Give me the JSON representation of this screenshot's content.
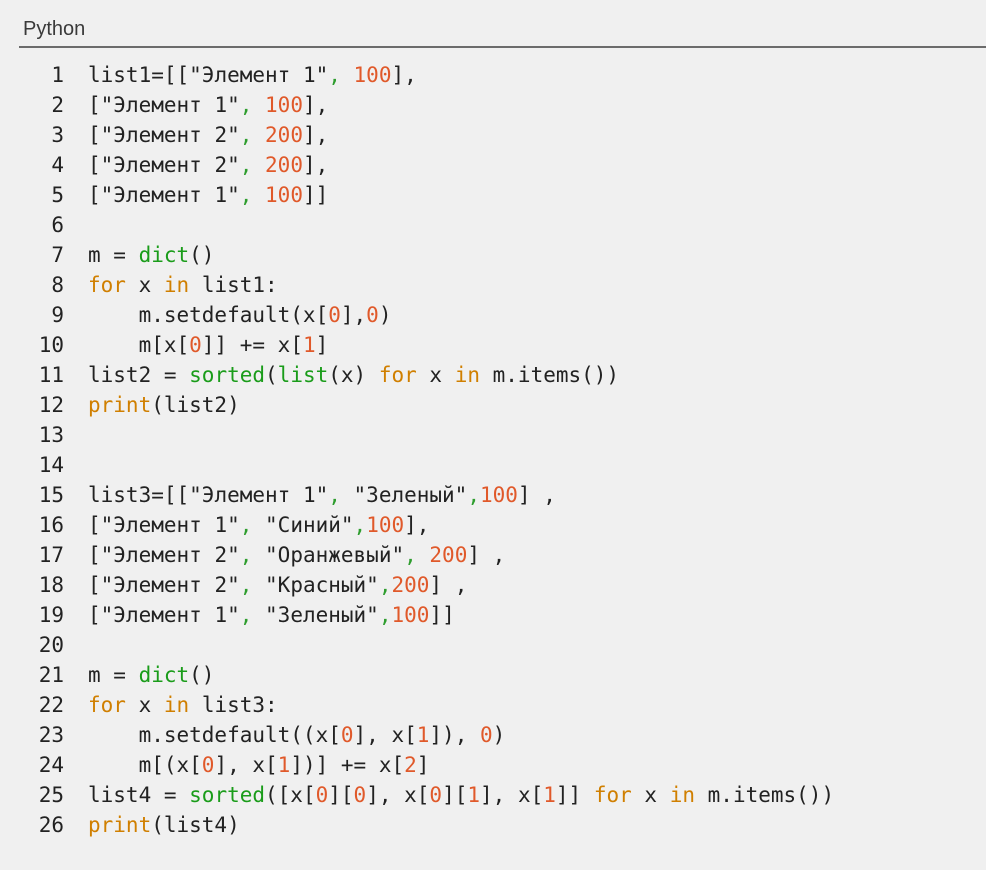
{
  "header": {
    "language": "Python"
  },
  "colors": {
    "keyword": "#d07f00",
    "builtin": "#1a9c1a",
    "number": "#e0592a",
    "punctuation": "#2e9d2e",
    "text": "#222222",
    "background": "#f0f0f0"
  },
  "lines": [
    {
      "num": "1",
      "tokens": [
        {
          "t": "list1=[[",
          "c": "d"
        },
        {
          "t": "\"Элемент 1\"",
          "c": "s"
        },
        {
          "t": ", ",
          "c": "p"
        },
        {
          "t": "100",
          "c": "n"
        },
        {
          "t": "],",
          "c": "d"
        }
      ]
    },
    {
      "num": "2",
      "tokens": [
        {
          "t": "[",
          "c": "d"
        },
        {
          "t": "\"Элемент 1\"",
          "c": "s"
        },
        {
          "t": ", ",
          "c": "p"
        },
        {
          "t": "100",
          "c": "n"
        },
        {
          "t": "],",
          "c": "d"
        }
      ]
    },
    {
      "num": "3",
      "tokens": [
        {
          "t": "[",
          "c": "d"
        },
        {
          "t": "\"Элемент 2\"",
          "c": "s"
        },
        {
          "t": ", ",
          "c": "p"
        },
        {
          "t": "200",
          "c": "n"
        },
        {
          "t": "],",
          "c": "d"
        }
      ]
    },
    {
      "num": "4",
      "tokens": [
        {
          "t": "[",
          "c": "d"
        },
        {
          "t": "\"Элемент 2\"",
          "c": "s"
        },
        {
          "t": ", ",
          "c": "p"
        },
        {
          "t": "200",
          "c": "n"
        },
        {
          "t": "],",
          "c": "d"
        }
      ]
    },
    {
      "num": "5",
      "tokens": [
        {
          "t": "[",
          "c": "d"
        },
        {
          "t": "\"Элемент 1\"",
          "c": "s"
        },
        {
          "t": ", ",
          "c": "p"
        },
        {
          "t": "100",
          "c": "n"
        },
        {
          "t": "]]",
          "c": "d"
        }
      ]
    },
    {
      "num": "6",
      "tokens": []
    },
    {
      "num": "7",
      "tokens": [
        {
          "t": "m = ",
          "c": "d"
        },
        {
          "t": "dict",
          "c": "f"
        },
        {
          "t": "()",
          "c": "d"
        }
      ]
    },
    {
      "num": "8",
      "tokens": [
        {
          "t": "for",
          "c": "k"
        },
        {
          "t": " x ",
          "c": "d"
        },
        {
          "t": "in",
          "c": "k"
        },
        {
          "t": " list1:",
          "c": "d"
        }
      ]
    },
    {
      "num": "9",
      "tokens": [
        {
          "t": "    m.setdefault(x[",
          "c": "d"
        },
        {
          "t": "0",
          "c": "n"
        },
        {
          "t": "],",
          "c": "d"
        },
        {
          "t": "0",
          "c": "n"
        },
        {
          "t": ")",
          "c": "d"
        }
      ]
    },
    {
      "num": "10",
      "tokens": [
        {
          "t": "    m[x[",
          "c": "d"
        },
        {
          "t": "0",
          "c": "n"
        },
        {
          "t": "]] += x[",
          "c": "d"
        },
        {
          "t": "1",
          "c": "n"
        },
        {
          "t": "]",
          "c": "d"
        }
      ]
    },
    {
      "num": "11",
      "tokens": [
        {
          "t": "list2 = ",
          "c": "d"
        },
        {
          "t": "sorted",
          "c": "f"
        },
        {
          "t": "(",
          "c": "d"
        },
        {
          "t": "list",
          "c": "f"
        },
        {
          "t": "(x) ",
          "c": "d"
        },
        {
          "t": "for",
          "c": "k"
        },
        {
          "t": " x ",
          "c": "d"
        },
        {
          "t": "in",
          "c": "k"
        },
        {
          "t": " m.items())",
          "c": "d"
        }
      ]
    },
    {
      "num": "12",
      "tokens": [
        {
          "t": "print",
          "c": "k"
        },
        {
          "t": "(list2)",
          "c": "d"
        }
      ]
    },
    {
      "num": "13",
      "tokens": []
    },
    {
      "num": "14",
      "tokens": []
    },
    {
      "num": "15",
      "tokens": [
        {
          "t": "list3=[[",
          "c": "d"
        },
        {
          "t": "\"Элемент 1\"",
          "c": "s"
        },
        {
          "t": ", ",
          "c": "p"
        },
        {
          "t": "\"Зеленый\"",
          "c": "s"
        },
        {
          "t": ",",
          "c": "p"
        },
        {
          "t": "100",
          "c": "n"
        },
        {
          "t": "] ,",
          "c": "d"
        }
      ]
    },
    {
      "num": "16",
      "tokens": [
        {
          "t": "[",
          "c": "d"
        },
        {
          "t": "\"Элемент 1\"",
          "c": "s"
        },
        {
          "t": ", ",
          "c": "p"
        },
        {
          "t": "\"Синий\"",
          "c": "s"
        },
        {
          "t": ",",
          "c": "p"
        },
        {
          "t": "100",
          "c": "n"
        },
        {
          "t": "],",
          "c": "d"
        }
      ]
    },
    {
      "num": "17",
      "tokens": [
        {
          "t": "[",
          "c": "d"
        },
        {
          "t": "\"Элемент 2\"",
          "c": "s"
        },
        {
          "t": ", ",
          "c": "p"
        },
        {
          "t": "\"Оранжевый\"",
          "c": "s"
        },
        {
          "t": ", ",
          "c": "p"
        },
        {
          "t": "200",
          "c": "n"
        },
        {
          "t": "] ,",
          "c": "d"
        }
      ]
    },
    {
      "num": "18",
      "tokens": [
        {
          "t": "[",
          "c": "d"
        },
        {
          "t": "\"Элемент 2\"",
          "c": "s"
        },
        {
          "t": ", ",
          "c": "p"
        },
        {
          "t": "\"Красный\"",
          "c": "s"
        },
        {
          "t": ",",
          "c": "p"
        },
        {
          "t": "200",
          "c": "n"
        },
        {
          "t": "] ,",
          "c": "d"
        }
      ]
    },
    {
      "num": "19",
      "tokens": [
        {
          "t": "[",
          "c": "d"
        },
        {
          "t": "\"Элемент 1\"",
          "c": "s"
        },
        {
          "t": ", ",
          "c": "p"
        },
        {
          "t": "\"Зеленый\"",
          "c": "s"
        },
        {
          "t": ",",
          "c": "p"
        },
        {
          "t": "100",
          "c": "n"
        },
        {
          "t": "]]",
          "c": "d"
        }
      ]
    },
    {
      "num": "20",
      "tokens": []
    },
    {
      "num": "21",
      "tokens": [
        {
          "t": "m = ",
          "c": "d"
        },
        {
          "t": "dict",
          "c": "f"
        },
        {
          "t": "()",
          "c": "d"
        }
      ]
    },
    {
      "num": "22",
      "tokens": [
        {
          "t": "for",
          "c": "k"
        },
        {
          "t": " x ",
          "c": "d"
        },
        {
          "t": "in",
          "c": "k"
        },
        {
          "t": " list3:",
          "c": "d"
        }
      ]
    },
    {
      "num": "23",
      "tokens": [
        {
          "t": "    m.setdefault((x[",
          "c": "d"
        },
        {
          "t": "0",
          "c": "n"
        },
        {
          "t": "], x[",
          "c": "d"
        },
        {
          "t": "1",
          "c": "n"
        },
        {
          "t": "]), ",
          "c": "d"
        },
        {
          "t": "0",
          "c": "n"
        },
        {
          "t": ")",
          "c": "d"
        }
      ]
    },
    {
      "num": "24",
      "tokens": [
        {
          "t": "    m[(x[",
          "c": "d"
        },
        {
          "t": "0",
          "c": "n"
        },
        {
          "t": "], x[",
          "c": "d"
        },
        {
          "t": "1",
          "c": "n"
        },
        {
          "t": "])] += x[",
          "c": "d"
        },
        {
          "t": "2",
          "c": "n"
        },
        {
          "t": "]",
          "c": "d"
        }
      ]
    },
    {
      "num": "25",
      "tokens": [
        {
          "t": "list4 = ",
          "c": "d"
        },
        {
          "t": "sorted",
          "c": "f"
        },
        {
          "t": "([x[",
          "c": "d"
        },
        {
          "t": "0",
          "c": "n"
        },
        {
          "t": "][",
          "c": "d"
        },
        {
          "t": "0",
          "c": "n"
        },
        {
          "t": "], x[",
          "c": "d"
        },
        {
          "t": "0",
          "c": "n"
        },
        {
          "t": "][",
          "c": "d"
        },
        {
          "t": "1",
          "c": "n"
        },
        {
          "t": "], x[",
          "c": "d"
        },
        {
          "t": "1",
          "c": "n"
        },
        {
          "t": "]] ",
          "c": "d"
        },
        {
          "t": "for",
          "c": "k"
        },
        {
          "t": " x ",
          "c": "d"
        },
        {
          "t": "in",
          "c": "k"
        },
        {
          "t": " m.items())",
          "c": "d"
        }
      ]
    },
    {
      "num": "26",
      "tokens": [
        {
          "t": "print",
          "c": "k"
        },
        {
          "t": "(list4)",
          "c": "d"
        }
      ]
    }
  ]
}
